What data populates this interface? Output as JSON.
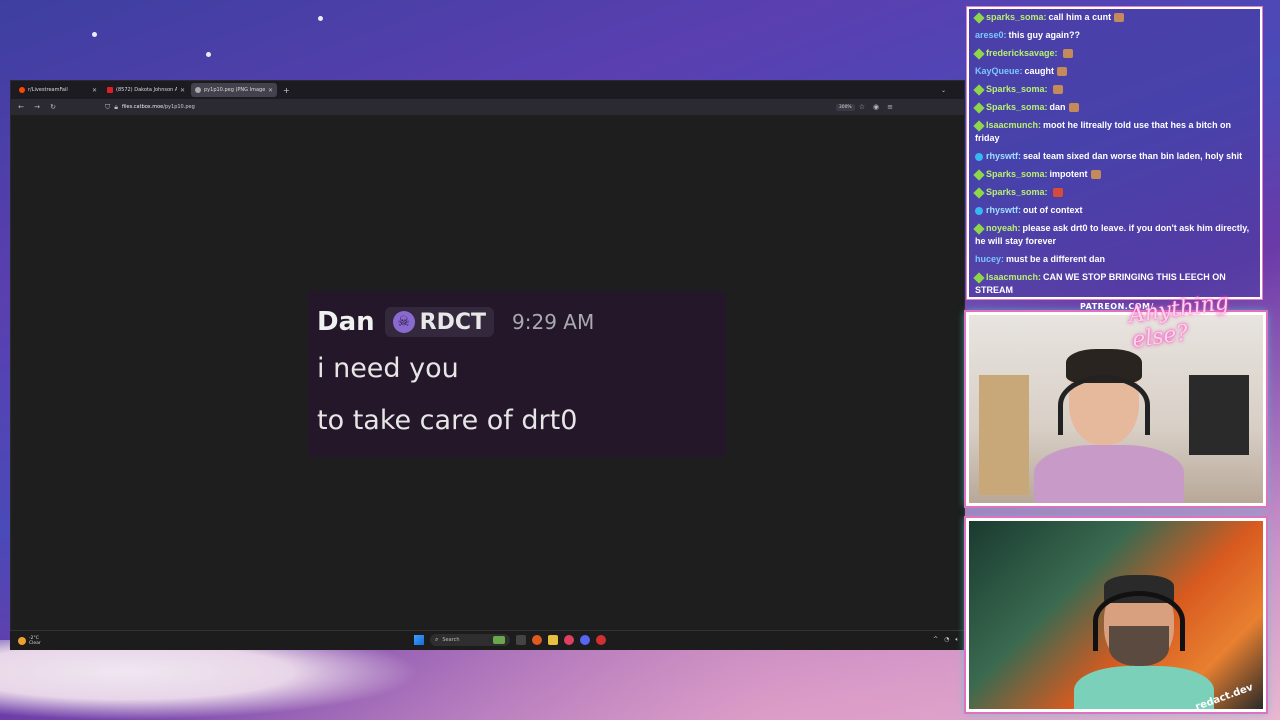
{
  "colors": {
    "chat_border": "#ffffff",
    "cam_glow": "#e070c0",
    "message_bg": "#24172a",
    "accent_green": "#8cd84a",
    "accent_blue": "#38b8f0"
  },
  "browser": {
    "tabs": [
      {
        "title": "r/LivestreamFail",
        "icon": "reddit-icon"
      },
      {
        "title": "(8572) Dakota Johnson Almost",
        "icon": "youtube-icon"
      },
      {
        "title": "py1p10.peg (PNG Image, 212 ×",
        "icon": "image-icon",
        "active": true
      }
    ],
    "new_tab": "+",
    "tab_list": "⌄",
    "url_host": "files.catbox.moe",
    "url_path": "/py1p10.peg",
    "zoom": "300%"
  },
  "message": {
    "author": "Dan",
    "tag": "RDCT",
    "time": "9:29 AM",
    "lines": [
      "i need you",
      "to take care of drt0"
    ]
  },
  "taskbar": {
    "weather_temp": "-2°C",
    "weather_desc": "Clear",
    "search_label": "Search"
  },
  "chat": {
    "messages": [
      {
        "user": "sparks_soma:",
        "text": "call him a cunt",
        "badge": "green"
      },
      {
        "user": "arese0:",
        "text": "this guy again??",
        "badge": ""
      },
      {
        "user": "fredericksavage:",
        "text": "",
        "badge": "green"
      },
      {
        "user": "KayQueue:",
        "text": "caught",
        "badge": ""
      },
      {
        "user": "Sparks_soma:",
        "text": "",
        "badge": "green"
      },
      {
        "user": "Sparks_soma:",
        "text": "dan",
        "badge": "green"
      },
      {
        "user": "Isaacmunch:",
        "text": "moot he litreally told use that hes a bitch on friday",
        "badge": "green"
      },
      {
        "user": "rhyswtf:",
        "text": "seal team sixed dan worse than bin laden, holy shit",
        "badge": "blue"
      },
      {
        "user": "Sparks_soma:",
        "text": "impotent",
        "badge": "green"
      },
      {
        "user": "Sparks_soma:",
        "text": "",
        "badge": "green"
      },
      {
        "user": "rhyswtf:",
        "text": "out of context",
        "badge": "blue"
      },
      {
        "user": "noyeah:",
        "text": "please ask drt0 to leave. if you don't ask him directly, he will stay forever",
        "badge": "green"
      },
      {
        "user": "hucey:",
        "text": "must be a different dan",
        "badge": ""
      },
      {
        "user": "Isaacmunch:",
        "text": "CAN WE STOP BRINGING THIS LEECH ON STREAM",
        "badge": "green"
      }
    ]
  },
  "overlay": {
    "patreon": "PATREON.COM/",
    "brand": "Anything else?",
    "cam2_watermark": "redact.dev"
  }
}
